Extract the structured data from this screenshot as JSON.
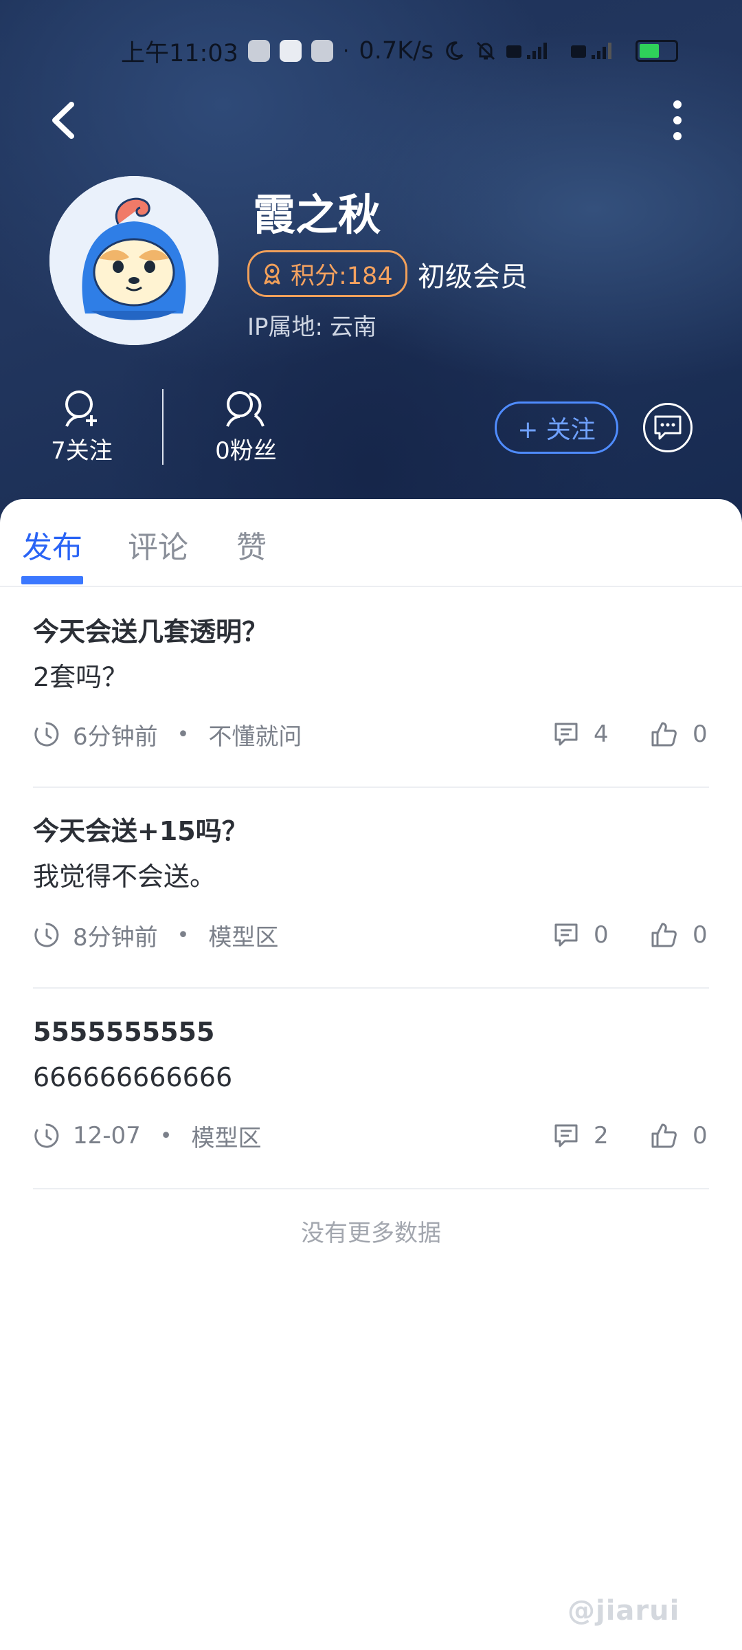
{
  "status_bar": {
    "time": "上午11:03",
    "dot": "·",
    "network_speed": "0.7K/s",
    "battery": "50"
  },
  "header": {
    "back_icon": "chevron-left-icon",
    "more_icon": "more-vertical-icon"
  },
  "profile": {
    "name": "霞之秋",
    "points_label": "积分:184",
    "level": "初级会员",
    "ip_label": "IP属地:",
    "ip_value": "云南",
    "following": "7关注",
    "followers": "0粉丝",
    "follow_button": "+ 关注"
  },
  "tabs": [
    {
      "label": "发布",
      "active": true
    },
    {
      "label": "评论",
      "active": false
    },
    {
      "label": "赞",
      "active": false
    }
  ],
  "posts": [
    {
      "title": "今天会送几套透明？",
      "body": "2套吗？",
      "time": "6分钟前",
      "category": "不懂就问",
      "comments": "4",
      "likes": "0"
    },
    {
      "title": "今天会送+15吗？",
      "body": "我觉得不会送。",
      "time": "8分钟前",
      "category": "模型区",
      "comments": "0",
      "likes": "0"
    },
    {
      "title": "5555555555",
      "body": "666666666666",
      "time": "12-07",
      "category": "模型区",
      "comments": "2",
      "likes": "0"
    }
  ],
  "meta_dot": "•",
  "no_more": "没有更多数据",
  "watermark": "@jiarui",
  "colors": {
    "accent": "#3b78ff",
    "points": "#f1a05a",
    "header_bg": "#1d3158"
  }
}
